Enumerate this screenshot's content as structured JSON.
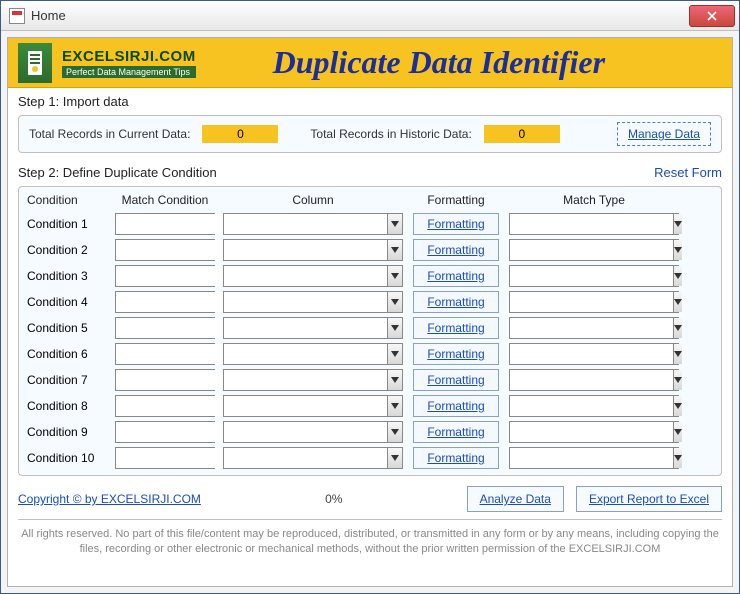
{
  "window": {
    "title": "Home"
  },
  "header": {
    "logo_main": "EXCELSIRJI.COM",
    "logo_sub": "Perfect Data Management Tips",
    "title": "Duplicate Data Identifier"
  },
  "step1": {
    "header": "Step 1: Import data",
    "current_label": "Total Records in Current Data:",
    "current_value": "0",
    "historic_label": "Total Records in Historic Data:",
    "historic_value": "0",
    "manage_btn": "Manage Data"
  },
  "step2": {
    "header": "Step 2: Define Duplicate Condition",
    "reset_link": "Reset Form",
    "columns": {
      "condition": "Condition",
      "match": "Match Condition",
      "column": "Column",
      "formatting": "Formatting",
      "matchtype": "Match Type"
    },
    "fmt_btn": "Formatting",
    "rows": [
      {
        "name": "Condition 1"
      },
      {
        "name": "Condition 2"
      },
      {
        "name": "Condition 3"
      },
      {
        "name": "Condition 4"
      },
      {
        "name": "Condition 5"
      },
      {
        "name": "Condition 6"
      },
      {
        "name": "Condition 7"
      },
      {
        "name": "Condition 8"
      },
      {
        "name": "Condition 9"
      },
      {
        "name": "Condition 10"
      }
    ]
  },
  "footer": {
    "copyright": "Copyright © by EXCELSIRJI.COM",
    "progress": "0%",
    "analyze_btn": "Analyze Data",
    "export_btn": "Export Report to Excel",
    "disclaimer": "All rights reserved. No part of this file/content may be reproduced, distributed, or transmitted in any form or by any means, including copying the files, recording or other electronic or mechanical methods, without the prior written permission of the EXCELSIRJI.COM"
  }
}
